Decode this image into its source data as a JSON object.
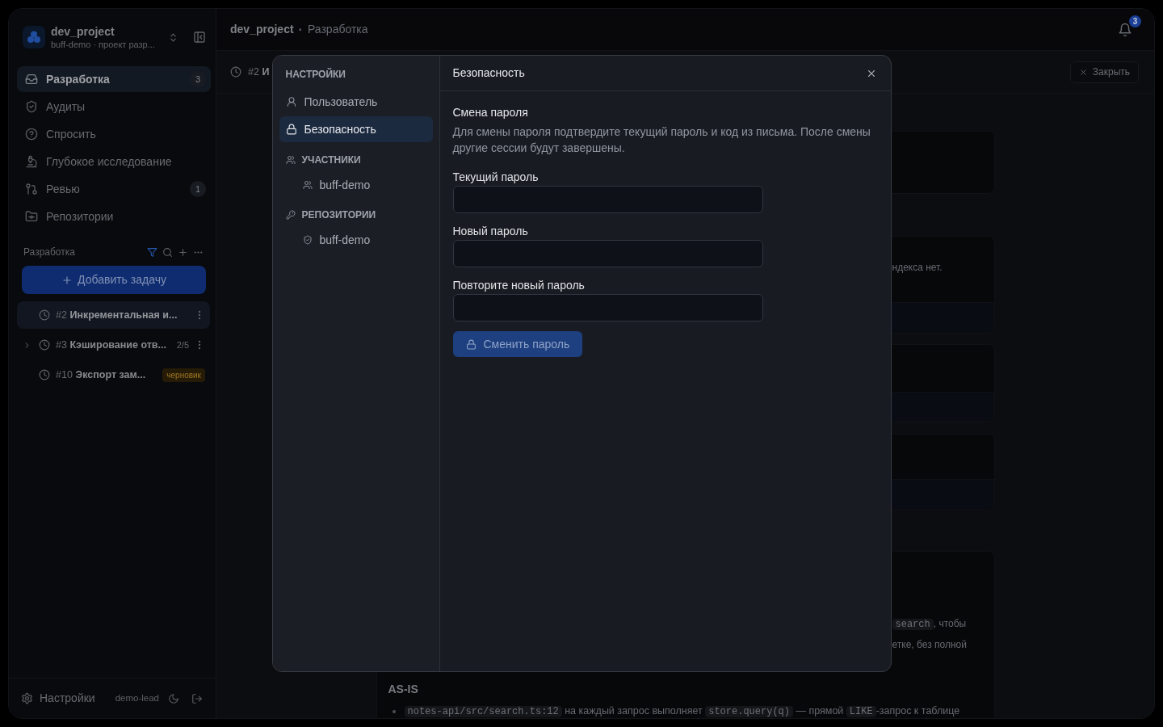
{
  "sidebar": {
    "project": {
      "name": "dev_project",
      "subtitle": "buff-demo · проект разр..."
    },
    "nav": [
      {
        "label": "Разработка",
        "selected": true,
        "count": "3"
      },
      {
        "label": "Аудиты",
        "selected": false
      },
      {
        "label": "Спросить",
        "selected": false
      },
      {
        "label": "Глубокое исследование",
        "selected": false
      },
      {
        "label": "Ревью",
        "selected": false,
        "count": "1"
      },
      {
        "label": "Репозитории",
        "selected": false
      }
    ],
    "section_title": "Разработка",
    "add_button": "Добавить задачу",
    "tasks": [
      {
        "number": "#2",
        "title": "Инкрементальная и...",
        "selected": true
      },
      {
        "number": "#3",
        "title": "Кэширование отв...",
        "progress": "2/5",
        "expanded": false,
        "selected": false
      },
      {
        "number": "#10",
        "title": "Экспорт зам...",
        "badge": "черновик",
        "selected": false
      }
    ],
    "footer": {
      "settings": "Настройки",
      "user": "demo-lead"
    }
  },
  "header": {
    "project": "dev_project",
    "separator": "·",
    "page": "Разработка",
    "notifications": "3"
  },
  "task_bar": {
    "number": "#2",
    "title": "И",
    "close_button": "Закрыть"
  },
  "content": {
    "fragment": "ндекса нет.",
    "lines": [
      {
        "segments": [
          {
            "kind": "code",
            "text": "search"
          },
          {
            "kind": "text",
            "text": ", чтобы"
          }
        ]
      },
      {
        "segments": [
          {
            "kind": "text",
            "text": "етке, без полной"
          }
        ]
      }
    ],
    "as_is": {
      "title": "AS-IS",
      "items": [
        {
          "segments": [
            {
              "kind": "code",
              "text": "notes-api/src/search.ts:12"
            },
            {
              "kind": "text",
              "text": " на каждый запрос выполняет "
            },
            {
              "kind": "code",
              "text": "store.query(q)"
            },
            {
              "kind": "text",
              "text": " — прямой "
            },
            {
              "kind": "code",
              "text": "LIKE"
            },
            {
              "kind": "text",
              "text": "-запрос к таблице"
            }
          ]
        }
      ]
    }
  },
  "modal": {
    "nav_title": "НАСТРОЙКИ",
    "nav": [
      {
        "kind": "item",
        "label": "Пользователь",
        "selected": false
      },
      {
        "kind": "item",
        "label": "Безопасность",
        "selected": true
      },
      {
        "kind": "section",
        "label": "УЧАСТНИКИ",
        "children": [
          {
            "label": "buff-demo",
            "selected": false
          }
        ]
      },
      {
        "kind": "section",
        "label": "РЕПОЗИТОРИИ",
        "children": [
          {
            "label": "buff-demo",
            "selected": false
          }
        ]
      }
    ],
    "title": "Безопасность",
    "section_title": "Смена пароля",
    "description": "Для смены пароля подтвердите текущий пароль и код из письма. После смены другие сессии будут завершены.",
    "fields": [
      {
        "label": "Текущий пароль"
      },
      {
        "label": "Новый пароль"
      },
      {
        "label": "Повторите новый пароль"
      }
    ],
    "submit": {
      "label": "Сменить пароль",
      "disabled": true
    }
  }
}
